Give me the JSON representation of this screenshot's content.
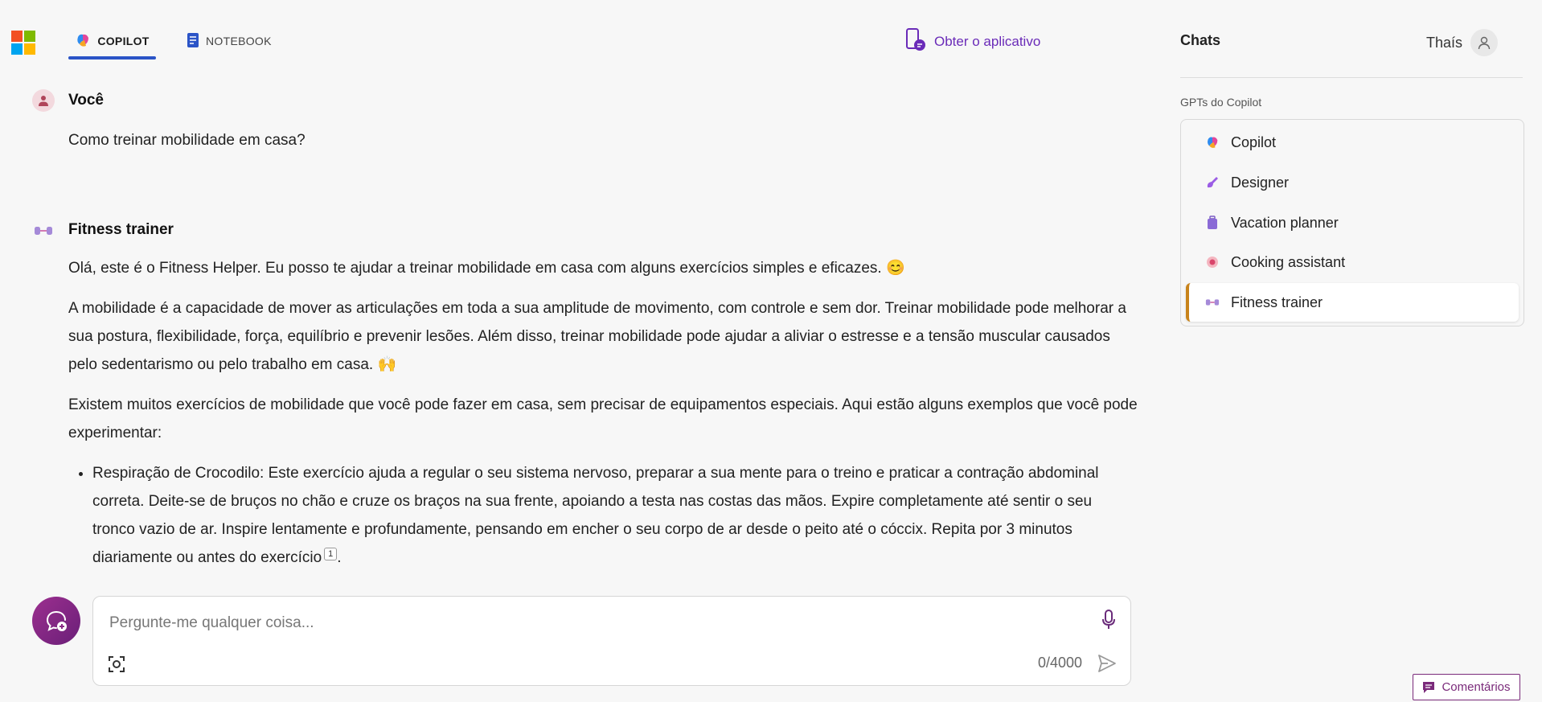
{
  "header": {
    "logo_colors": [
      "#f25022",
      "#7fba00",
      "#00a4ef",
      "#ffb900"
    ],
    "tabs": [
      {
        "label": "COPILOT",
        "icon": "copilot-icon",
        "active": true
      },
      {
        "label": "NOTEBOOK",
        "icon": "notebook-icon",
        "active": false
      }
    ],
    "get_app": {
      "label": "Obter o aplicativo",
      "icon": "phone-icon"
    }
  },
  "sidebar": {
    "title": "Chats",
    "user_name": "Thaís",
    "gpts_label": "GPTs do Copilot",
    "items": [
      {
        "label": "Copilot",
        "icon": "copilot-icon",
        "active": false
      },
      {
        "label": "Designer",
        "icon": "designer-icon",
        "active": false
      },
      {
        "label": "Vacation planner",
        "icon": "suitcase-icon",
        "active": false
      },
      {
        "label": "Cooking assistant",
        "icon": "cooking-icon",
        "active": false
      },
      {
        "label": "Fitness trainer",
        "icon": "dumbbell-icon",
        "active": true
      }
    ]
  },
  "conversation": {
    "user": {
      "name": "Você",
      "text": "Como treinar mobilidade em casa?"
    },
    "assistant": {
      "name": "Fitness trainer",
      "paragraphs": [
        "Olá, este é o Fitness Helper. Eu posso te ajudar a treinar mobilidade em casa com alguns exercícios simples e eficazes. 😊",
        "A mobilidade é a capacidade de mover as articulações em toda a sua amplitude de movimento, com controle e sem dor. Treinar mobilidade pode melhorar a sua postura, flexibilidade, força, equilíbrio e prevenir lesões. Além disso, treinar mobilidade pode ajudar a aliviar o estresse e a tensão muscular causados pelo sedentarismo ou pelo trabalho em casa. 🙌",
        "Existem muitos exercícios de mobilidade que você pode fazer em casa, sem precisar de equipamentos especiais. Aqui estão alguns exemplos que você pode experimentar:"
      ],
      "bullets": [
        {
          "text": "Respiração de Crocodilo: Este exercício ajuda a regular o seu sistema nervoso, preparar a sua mente para o treino e praticar a contração abdominal correta. Deite-se de bruços no chão e cruze os braços na sua frente, apoiando a testa nas costas das mãos. Expire completamente até sentir o seu tronco vazio de ar. Inspire lentamente e profundamente, pensando em encher o seu corpo de ar desde o peito até o cóccix. Repita por 3 minutos diariamente ou antes do exercício",
          "citation": "1",
          "after": "."
        }
      ]
    }
  },
  "composer": {
    "placeholder": "Pergunte-me qualquer coisa...",
    "value": "",
    "counter": "0/4000"
  },
  "feedback": {
    "label": "Comentários"
  }
}
